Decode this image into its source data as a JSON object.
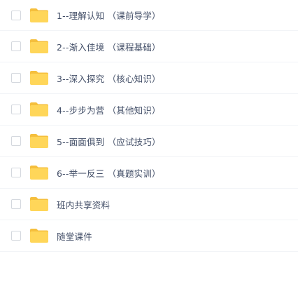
{
  "colors": {
    "folder_body": "#FFD659",
    "folder_tab": "#F5BF3D",
    "divider": "#F2F4F7",
    "text": "#424E67",
    "checkbox_border": "#D4D8DE"
  },
  "file_list": {
    "items": [
      {
        "name": "1--理解认知 （课前导学）",
        "icon": "folder-icon"
      },
      {
        "name": "2--渐入佳境 （课程基础）",
        "icon": "folder-icon"
      },
      {
        "name": "3--深入探究 （核心知识）",
        "icon": "folder-icon"
      },
      {
        "name": "4--步步为营 （其他知识）",
        "icon": "folder-icon"
      },
      {
        "name": "5--面面俱到 （应试技巧）",
        "icon": "folder-icon"
      },
      {
        "name": "6--举一反三 （真题实训）",
        "icon": "folder-icon"
      },
      {
        "name": "班内共享资料",
        "icon": "folder-icon"
      },
      {
        "name": "随堂课件",
        "icon": "folder-icon"
      }
    ]
  }
}
